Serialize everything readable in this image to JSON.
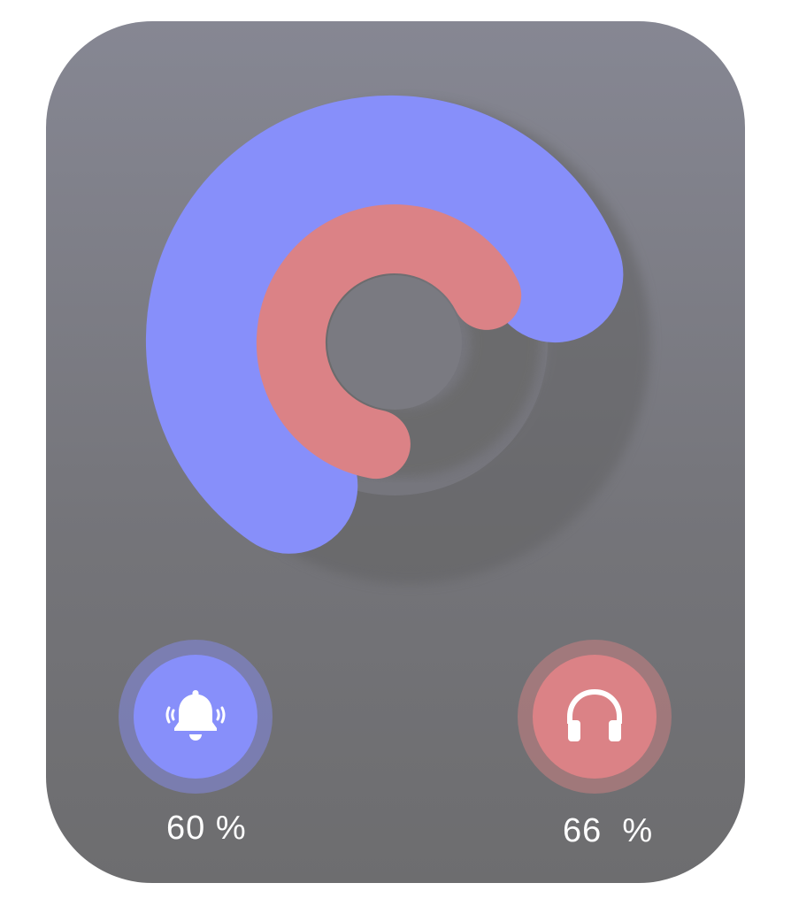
{
  "colors": {
    "card_top": "#868793",
    "card_bottom": "#6d6d6f",
    "blue_accent": "#878ffa",
    "red_accent": "#db8286",
    "text": "#ffffff"
  },
  "rings": [
    {
      "name": "notification-volume",
      "color": "#878ffa",
      "fill_fraction": 0.6
    },
    {
      "name": "headphone-volume",
      "color": "#db8286",
      "fill_fraction": 0.66
    }
  ],
  "controls": {
    "notification": {
      "icon": "bell-ringing-icon",
      "value_label": "60 %",
      "color": "#878ffa"
    },
    "headphone": {
      "icon": "headphones-icon",
      "value_label": "66  %",
      "color": "#db8286"
    }
  }
}
